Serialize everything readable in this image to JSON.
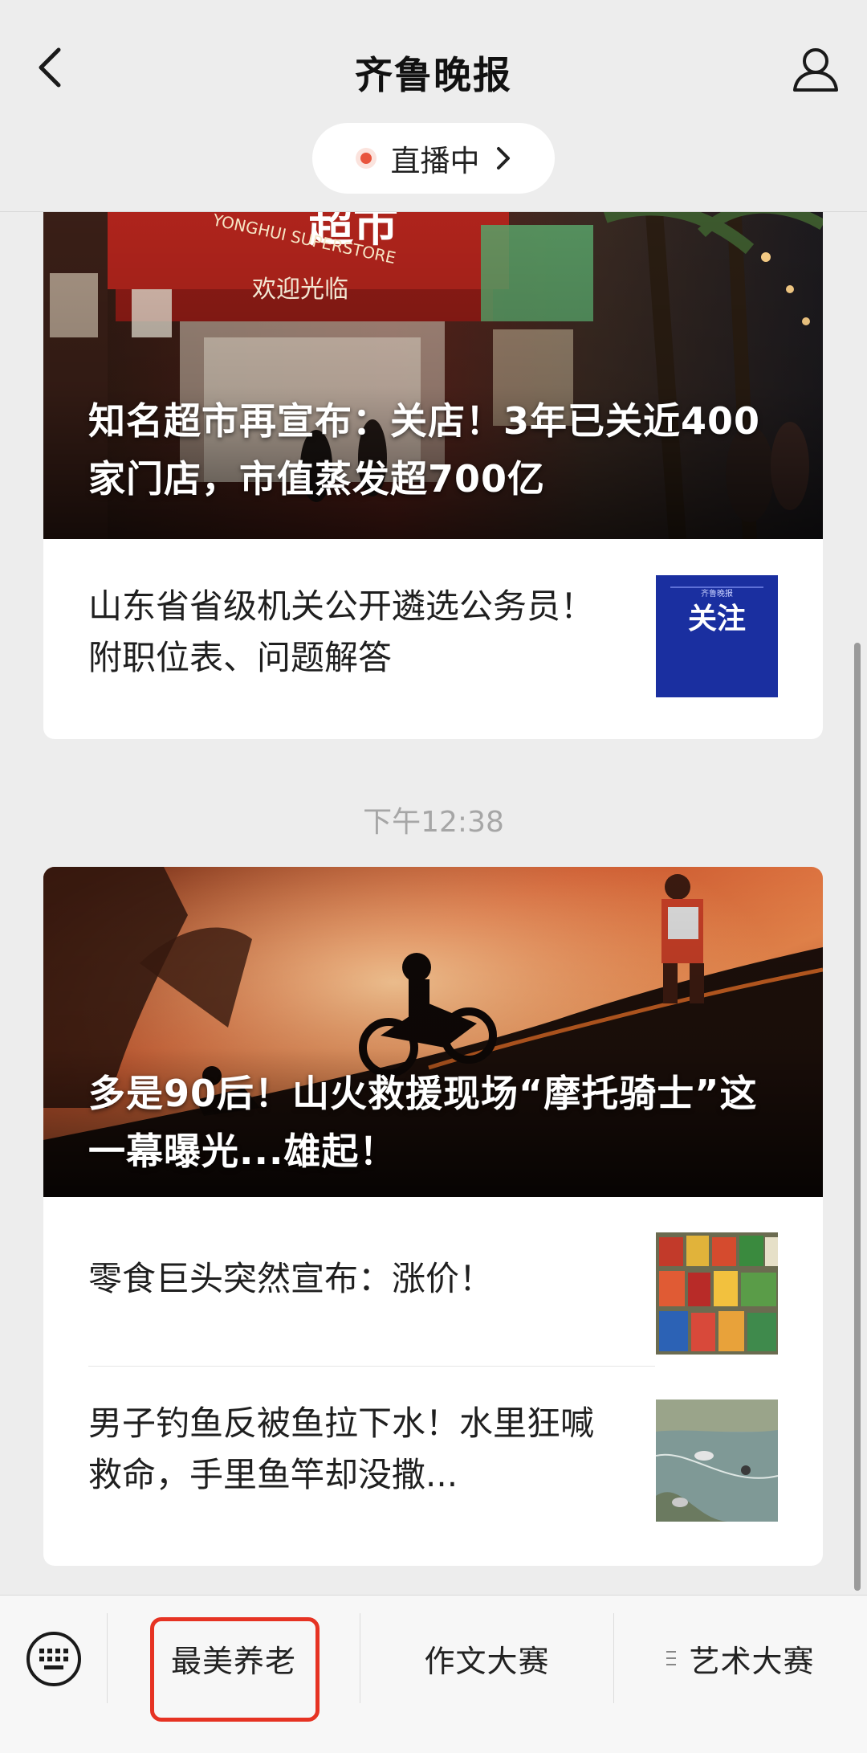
{
  "header": {
    "title": "齐鲁晚报",
    "live_label": "直播中"
  },
  "feed": {
    "group1": {
      "hero_caption": "知名超市再宣布：关店！3年已关近400家门店，市值蒸发超700亿",
      "hero_sign_text": "超市",
      "hero_sign_sub": "YONGHUI SUPERSTORE",
      "hero_welcome": "欢迎光临",
      "rows": [
        {
          "title": "山东省省级机关公开遴选公务员！附职位表、问题解答",
          "thumb_text": "关注",
          "thumb_small": "齐鲁晚报"
        }
      ]
    },
    "timestamp": "下午12:38",
    "group2": {
      "hero_caption": "多是90后！山火救援现场“摩托骑士”这一幕曝光...雄起！",
      "rows": [
        {
          "title": "零食巨头突然宣布：涨价！"
        },
        {
          "title": "男子钓鱼反被鱼拉下水！水里狂喊救命，手里鱼竿却没撒..."
        }
      ]
    }
  },
  "bottom_menu": {
    "items": [
      {
        "label": "最美养老"
      },
      {
        "label": "作文大赛"
      },
      {
        "label": "艺术大赛"
      }
    ]
  },
  "colors": {
    "highlight_box": "#e63323",
    "live_dot": "#e8553e",
    "follow_thumb_bg": "#1a2fa0"
  }
}
